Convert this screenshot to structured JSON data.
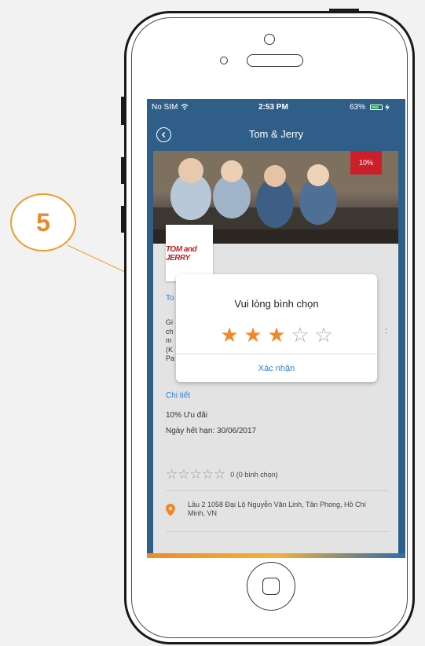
{
  "callout": {
    "number": "5"
  },
  "status_bar": {
    "carrier": "No SIM",
    "time": "2:53 PM",
    "battery": "63%"
  },
  "nav": {
    "title": "Tom & Jerry"
  },
  "banner": {
    "discount_badge": "10%"
  },
  "brand": {
    "logo_text": "TOM and JERRY",
    "name_peek": "To"
  },
  "description_peek": "Gi\nch\nm\n(K\nPa",
  "detail_link": "Chi tiết",
  "offer": "10% Ưu đãi",
  "expiry": "Ngày hết hạn: 30/06/2017",
  "rating": {
    "count_text": "0 (0 bình chọn)",
    "stars_max": 5,
    "value": 0
  },
  "address": "Lầu 2 1058 Đại Lộ Nguyễn Văn Linh, Tân Phong, Hồ Chí Minh, VN",
  "dialog": {
    "title": "Vui lòng bình chọn",
    "selected_stars": 3,
    "max_stars": 5,
    "confirm_label": "Xác nhận"
  },
  "colors": {
    "accent_orange": "#f0882a",
    "link_blue": "#2e7fd0",
    "nav_blue": "#2f5f88",
    "badge_red": "#cc1f2a"
  }
}
